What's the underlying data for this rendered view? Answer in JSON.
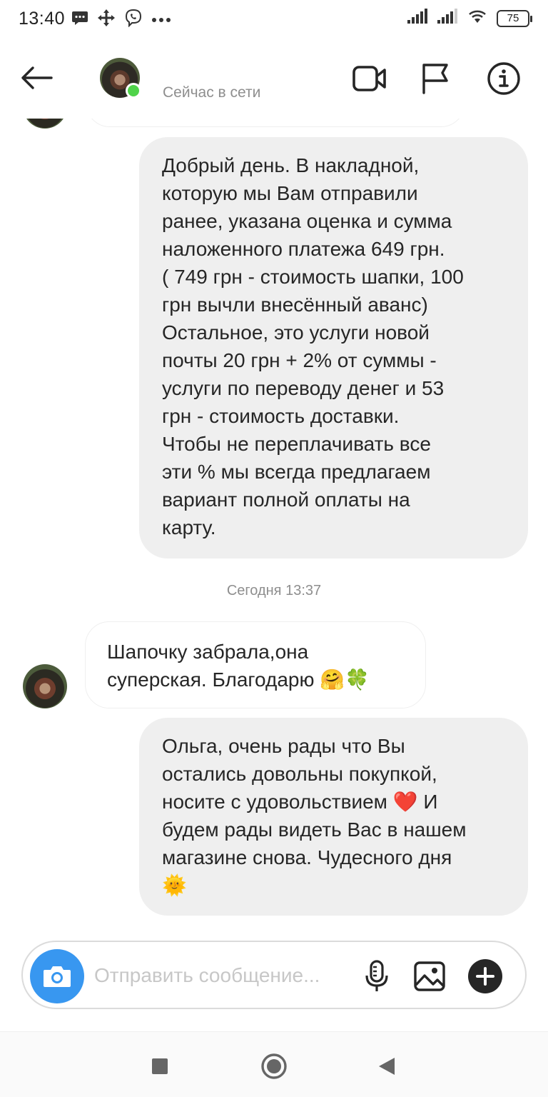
{
  "status_bar": {
    "time": "13:40",
    "battery": "75",
    "left_icons": [
      "message-icon",
      "move-icon",
      "viber-icon",
      "more-dots-icon"
    ],
    "right_icons": [
      "signal-icon",
      "signal-icon",
      "wifi-icon",
      "battery-icon"
    ]
  },
  "header": {
    "status": "Сейчас в сети",
    "icons": [
      "back-arrow-icon",
      "video-camera-icon",
      "flag-icon",
      "info-icon"
    ],
    "online_color": "#4fd34a"
  },
  "messages": {
    "outgoing_1": "Добрый день. В накладной, \nкоторую мы Вам отправили \nранее, указана оценка и сумма \nналоженного платежа 649 грн. \n( 749 грн - стоимость шапки, 100 \nгрн вычли внесённый аванс) \nОстальное, это услуги новой \nпочты 20 грн + 2% от суммы - \nуслуги по переводу денег и 53 \nгрн - стоимость доставки. \nЧтобы не переплачивать все \nэти % мы всегда предлагаем \nвариант полной оплаты на \nкарту.",
    "timestamp": "Сегодня 13:37",
    "incoming_1": "Шапочку забрала,она суперская. Благодарю 🤗🍀",
    "outgoing_2": "Ольга, очень рады что Вы \nостались довольны покупкой, \nносите с удовольствием ❤️ И \nбудем рады видеть Вас в нашем \nмагазине снова. Чудесного дня \n🌞"
  },
  "composer": {
    "placeholder": "Отправить сообщение...",
    "icons": [
      "camera-icon",
      "microphone-icon",
      "image-icon",
      "plus-icon"
    ],
    "accent": "#3897f0"
  },
  "nav_bar": {
    "icons": [
      "recent-apps-icon",
      "home-icon",
      "back-triangle-icon"
    ]
  },
  "colors": {
    "outgoing_bubble": "#efefef",
    "incoming_border": "#efefef",
    "secondary_text": "#8e8e8e"
  }
}
